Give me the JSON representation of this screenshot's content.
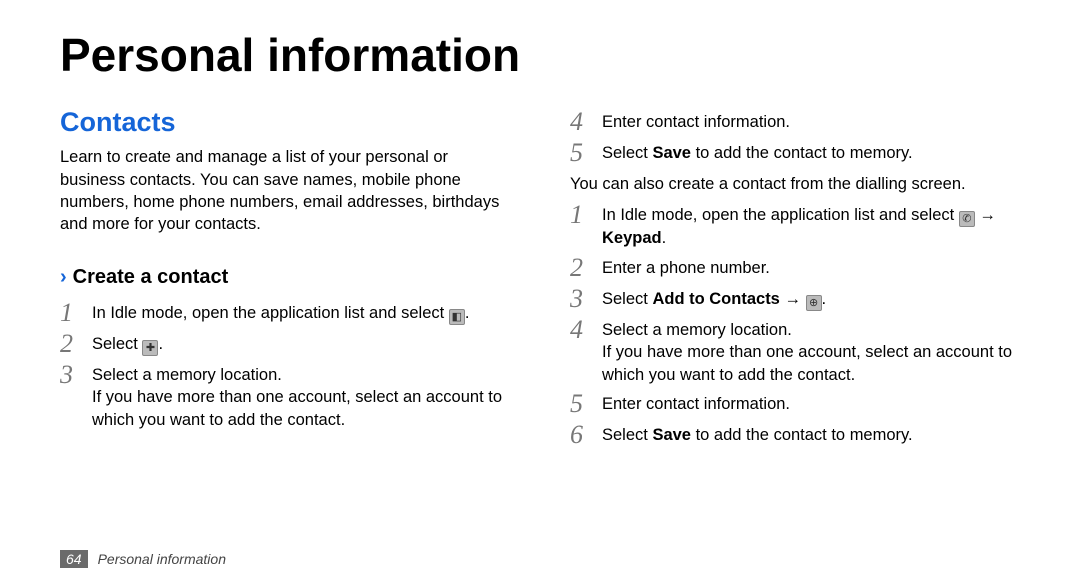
{
  "title": "Personal information",
  "section": {
    "heading": "Contacts",
    "intro": "Learn to create and manage a list of your personal or business contacts. You can save names, mobile phone numbers, home phone numbers, email addresses, birthdays and more for your contacts."
  },
  "sub": {
    "chevron": "›",
    "heading": "Create a contact"
  },
  "left": {
    "s1": {
      "num": "1",
      "text": "In Idle mode, open the application list and select "
    },
    "s2": {
      "num": "2",
      "text": "Select "
    },
    "s3": {
      "num": "3",
      "text": "Select a memory location.",
      "cont": "If you have more than one account, select an account to which you want to add the contact."
    }
  },
  "right": {
    "s4": {
      "num": "4",
      "text": "Enter contact information."
    },
    "s5": {
      "num": "5",
      "pre": "Select ",
      "bold": "Save",
      "post": " to add the contact to memory."
    },
    "plain": "You can also create a contact from the dialling screen.",
    "d1": {
      "num": "1",
      "pre": "In Idle mode, open the application list and select ",
      "arrow": " → ",
      "bold": "Keypad",
      "post": "."
    },
    "d2": {
      "num": "2",
      "text": "Enter a phone number."
    },
    "d3": {
      "num": "3",
      "pre": "Select ",
      "bold": "Add to Contacts",
      "arrow": " → ",
      "post": "."
    },
    "d4": {
      "num": "4",
      "text": "Select a memory location.",
      "cont": "If you have more than one account, select an account to which you want to add the contact."
    },
    "d5": {
      "num": "5",
      "text": "Enter contact information."
    },
    "d6": {
      "num": "6",
      "pre": "Select ",
      "bold": "Save",
      "post": " to add the contact to memory."
    }
  },
  "icons": {
    "contacts": "◧",
    "add": "✚",
    "phone": "✆",
    "new": "⊕"
  },
  "footer": {
    "page": "64",
    "label": "Personal information"
  }
}
